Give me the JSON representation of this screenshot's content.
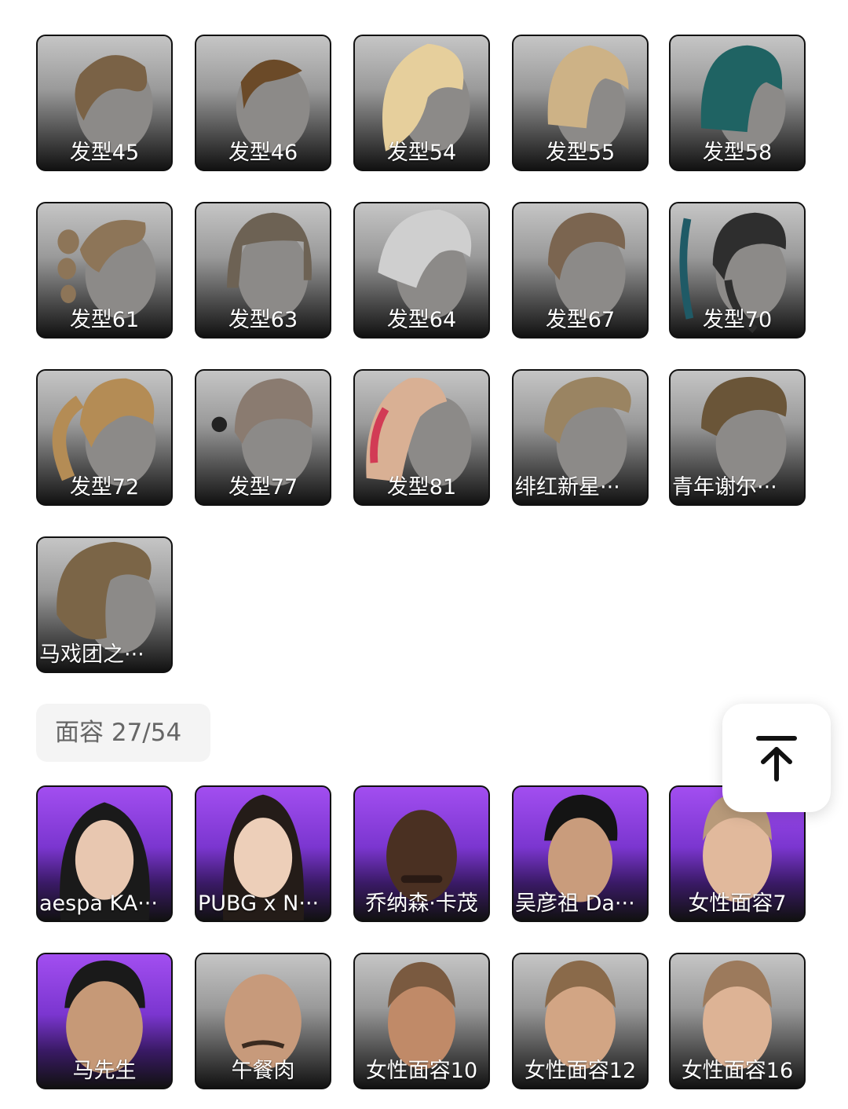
{
  "hairstyles": [
    {
      "label": "发型45",
      "hair": "#7a6246"
    },
    {
      "label": "发型46",
      "hair": "#6b4a28"
    },
    {
      "label": "发型54",
      "hair": "#e6cf9c"
    },
    {
      "label": "发型55",
      "hair": "#cdb286"
    },
    {
      "label": "发型58",
      "hair": "#1f6363"
    },
    {
      "label": "发型61",
      "hair": "#8d7558"
    },
    {
      "label": "发型63",
      "hair": "#6d6254"
    },
    {
      "label": "发型64",
      "hair": "#cfcfcf"
    },
    {
      "label": "发型67",
      "hair": "#7b6550"
    },
    {
      "label": "发型70",
      "hair": "#2e2e2e"
    },
    {
      "label": "发型72",
      "hair": "#b48c55"
    },
    {
      "label": "发型77",
      "hair": "#8a7b70"
    },
    {
      "label": "发型81",
      "hair": "#d9b094"
    },
    {
      "label": "绯红新星···",
      "hair": "#9a8462"
    },
    {
      "label": "青年谢尔···",
      "hair": "#6a5538"
    },
    {
      "label": "马戏团之···",
      "hair": "#7b6547"
    }
  ],
  "faces_section": {
    "title": "面容 27/54"
  },
  "faces": [
    {
      "label": "aespa KA···",
      "purple": true,
      "skin": "#e8c7b0",
      "hair": "#1a1a1a"
    },
    {
      "label": "PUBG x N···",
      "purple": true,
      "skin": "#edcfb9",
      "hair": "#241c18"
    },
    {
      "label": "乔纳森·卡茂",
      "purple": true,
      "skin": "#4a3022",
      "hair": "#2a1a14"
    },
    {
      "label": "吴彦祖 Da···",
      "purple": true,
      "skin": "#c99c7c",
      "hair": "#141414"
    },
    {
      "label": "女性面容7",
      "purple": true,
      "skin": "#e1b99c",
      "hair": "#b89a7a"
    },
    {
      "label": "马先生",
      "purple": true,
      "skin": "#c69977",
      "hair": "#1a1a1a"
    },
    {
      "label": "午餐肉",
      "purple": false,
      "skin": "#c79a7b",
      "hair": "#b08a6c"
    },
    {
      "label": "女性面容10",
      "purple": false,
      "skin": "#c08a68",
      "hair": "#7a5a40"
    },
    {
      "label": "女性面容12",
      "purple": false,
      "skin": "#d2a584",
      "hair": "#8a6a4a"
    },
    {
      "label": "女性面容16",
      "purple": false,
      "skin": "#ddb395",
      "hair": "#9c7a5c"
    }
  ]
}
